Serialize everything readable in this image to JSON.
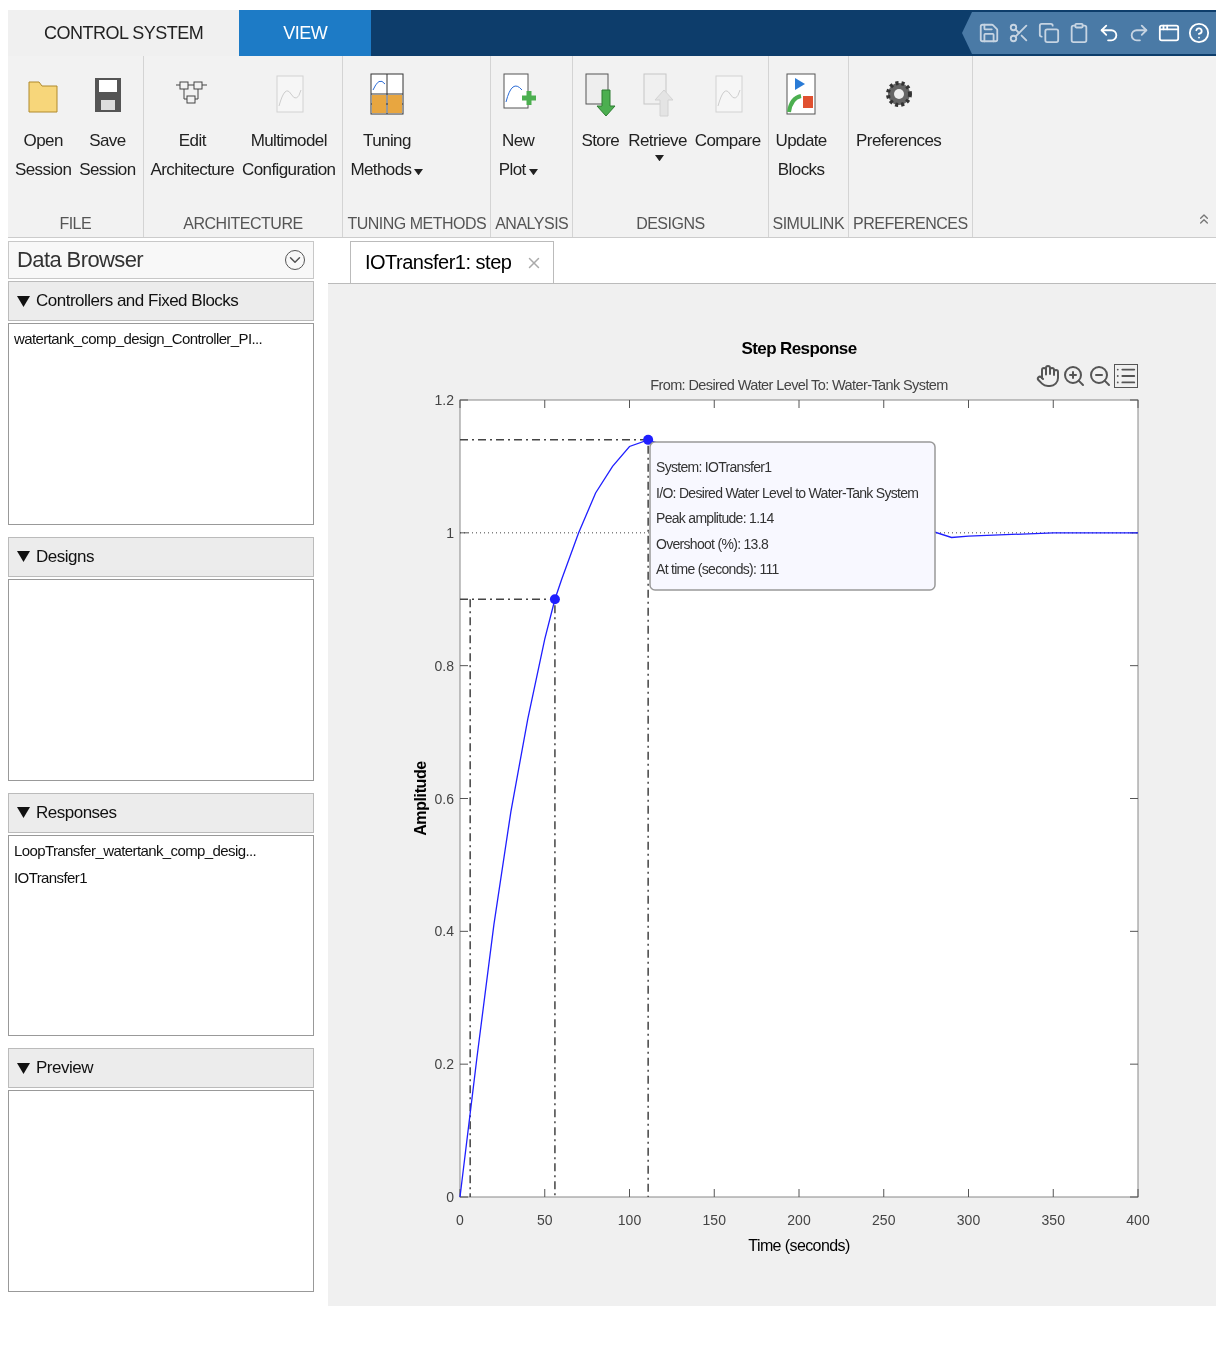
{
  "tabs": [
    {
      "label": "CONTROL SYSTEM",
      "selected": true
    },
    {
      "label": "VIEW",
      "selected": false
    }
  ],
  "ribbon": [
    {
      "label": "FILE",
      "buttons": [
        {
          "label": "Open\nSession",
          "disabled": false,
          "dropdown": false
        },
        {
          "label": "Save\nSession",
          "disabled": false,
          "dropdown": false
        }
      ]
    },
    {
      "label": "ARCHITECTURE",
      "buttons": [
        {
          "label": "Edit\nArchitecture",
          "disabled": false,
          "dropdown": false
        },
        {
          "label": "Multimodel\nConfiguration",
          "disabled": true,
          "dropdown": false
        }
      ]
    },
    {
      "label": "TUNING METHODS",
      "buttons": [
        {
          "label": "Tuning\nMethods",
          "disabled": false,
          "dropdown": true
        }
      ]
    },
    {
      "label": "ANALYSIS",
      "buttons": [
        {
          "label": "New\nPlot",
          "disabled": false,
          "dropdown": true
        }
      ]
    },
    {
      "label": "DESIGNS",
      "buttons": [
        {
          "label": "Store",
          "disabled": false,
          "dropdown": false
        },
        {
          "label": "Retrieve",
          "disabled": true,
          "dropdown": true
        },
        {
          "label": "Compare",
          "disabled": true,
          "dropdown": false
        }
      ]
    },
    {
      "label": "SIMULINK",
      "buttons": [
        {
          "label": "Update\nBlocks",
          "disabled": false,
          "dropdown": false
        }
      ]
    },
    {
      "label": "PREFERENCES",
      "buttons": [
        {
          "label": "Preferences",
          "disabled": false,
          "dropdown": false
        }
      ]
    }
  ],
  "data_browser": {
    "title": "Data Browser",
    "sections": [
      {
        "title": "Controllers and Fixed Blocks",
        "expanded": true,
        "items": [
          "watertank_comp_design_Controller_PI..."
        ]
      },
      {
        "title": "Designs",
        "expanded": true
      },
      {
        "title": "Responses",
        "expanded": true,
        "items": [
          "LoopTransfer_watertank_comp_desig...",
          "IOTransfer1"
        ]
      },
      {
        "title": "Preview",
        "expanded": true
      }
    ]
  },
  "document_tab": {
    "label": "IOTransfer1: step"
  },
  "plot": {
    "subtitle": "From: Desired  Water Level  To: Water-Tank System",
    "datatip": [
      "System: IOTransfer1",
      "I/O: Desired  Water Level to Water-Tank System",
      "Peak amplitude: 1.14",
      "Overshoot (%): 13.8",
      "At time (seconds): 111"
    ],
    "chart_data": {
      "type": "line",
      "title": "Step Response",
      "xlabel": "Time (seconds)",
      "ylabel": "Amplitude",
      "x": [
        0,
        6,
        10,
        20,
        30,
        40,
        50,
        56,
        60,
        70,
        80,
        90,
        100,
        111,
        290,
        300,
        350,
        400
      ],
      "series": [
        {
          "color": "#1f1fff",
          "values": [
            0,
            0.126,
            0.21,
            0.41,
            0.58,
            0.72,
            0.84,
            0.9,
            0.93,
            1.0,
            1.06,
            1.1,
            1.13,
            1.14,
            0.993,
            0.995,
            1.0,
            1.0
          ]
        }
      ],
      "xlim": [
        0,
        400
      ],
      "ylim": [
        0,
        1.2
      ],
      "xticks": [
        0,
        50,
        100,
        150,
        200,
        250,
        300,
        350,
        400
      ],
      "yticks": [
        {
          "value": 0,
          "label": "0"
        },
        {
          "value": 0.2,
          "label": "0.2"
        },
        {
          "value": 0.4,
          "label": "0.4"
        },
        {
          "value": 0.6,
          "label": "0.6"
        },
        {
          "value": 0.8,
          "label": "0.8"
        },
        {
          "value": 1,
          "label": "1"
        },
        {
          "value": 1.2,
          "label": "1.2"
        }
      ],
      "ref_lines": [
        {
          "axis": "y",
          "value": 1
        },
        {
          "axis": "x",
          "value": 6
        },
        {
          "axis": "x",
          "value": 56
        },
        {
          "axis": "x",
          "value": 111
        },
        {
          "axis": "y",
          "value": 0.9
        },
        {
          "axis": "y",
          "value": 1.14
        }
      ]
    }
  }
}
